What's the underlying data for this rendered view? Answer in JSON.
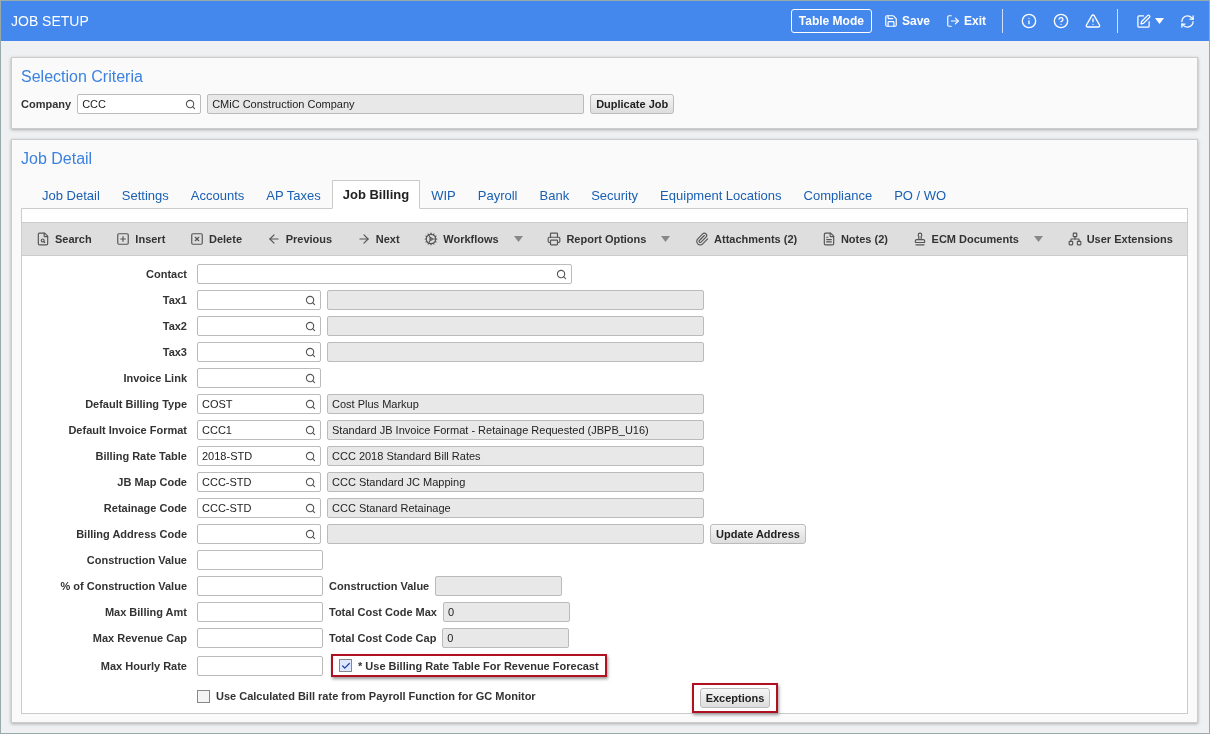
{
  "window": {
    "title": "JOB SETUP"
  },
  "header_actions": {
    "table_mode": "Table Mode",
    "save": "Save",
    "exit": "Exit"
  },
  "selection": {
    "title": "Selection Criteria",
    "company_label": "Company",
    "company_code": "CCC",
    "company_name": "CMiC Construction Company",
    "button": "Duplicate Job"
  },
  "detail": {
    "title": "Job Detail",
    "tabs": [
      {
        "label": "Job Detail",
        "selected": false
      },
      {
        "label": "Settings",
        "selected": false
      },
      {
        "label": "Accounts",
        "selected": false
      },
      {
        "label": "AP Taxes",
        "selected": false
      },
      {
        "label": "Job Billing",
        "selected": true
      },
      {
        "label": "WIP",
        "selected": false
      },
      {
        "label": "Payroll",
        "selected": false
      },
      {
        "label": "Bank",
        "selected": false
      },
      {
        "label": "Security",
        "selected": false
      },
      {
        "label": "Equipment Locations",
        "selected": false
      },
      {
        "label": "Compliance",
        "selected": false
      },
      {
        "label": "PO / WO",
        "selected": false
      }
    ],
    "toolbar": [
      {
        "label": "Search",
        "dropdown": false
      },
      {
        "label": "Insert",
        "dropdown": false
      },
      {
        "label": "Delete",
        "dropdown": false
      },
      {
        "label": "Previous",
        "dropdown": false
      },
      {
        "label": "Next",
        "dropdown": false
      },
      {
        "label": "Workflows",
        "dropdown": true
      },
      {
        "label": "Report Options",
        "dropdown": true
      },
      {
        "label": "Attachments (2)",
        "dropdown": false
      },
      {
        "label": "Notes (2)",
        "dropdown": false
      },
      {
        "label": "ECM Documents",
        "dropdown": true
      },
      {
        "label": "User Extensions",
        "dropdown": false
      }
    ],
    "fields": [
      {
        "kind": "search_wide",
        "label": "Contact"
      },
      {
        "kind": "lookup_desc",
        "label": "Tax1"
      },
      {
        "kind": "lookup_desc",
        "label": "Tax2"
      },
      {
        "kind": "lookup_desc",
        "label": "Tax3"
      },
      {
        "kind": "lookup",
        "label": "Invoice Link"
      },
      {
        "kind": "lookup_desc",
        "label": "Default Billing Type",
        "value": "COST",
        "description": "Cost Plus Markup"
      },
      {
        "kind": "lookup_desc",
        "label": "Default Invoice Format",
        "value": "CCC1",
        "description": "Standard JB Invoice Format - Retainage Requested (JBPB_U16)"
      },
      {
        "kind": "lookup_desc",
        "label": "Billing Rate Table",
        "value": "2018-STD",
        "description": "CCC 2018 Standard Bill Rates"
      },
      {
        "kind": "lookup_desc",
        "label": "JB Map Code",
        "value": "CCC-STD",
        "description": "CCC Standard JC Mapping"
      },
      {
        "kind": "lookup_desc",
        "label": "Retainage Code",
        "value": "CCC-STD",
        "description": "CCC Stanard Retainage"
      },
      {
        "kind": "lookup_desc",
        "label": "Billing Address Code",
        "button": "Update Address"
      },
      {
        "kind": "text",
        "label": "Construction Value"
      },
      {
        "kind": "text_pair",
        "label": "% of Construction Value",
        "side_label": "Construction Value"
      },
      {
        "kind": "text_pair",
        "label": "Max Billing Amt",
        "side_label": "Total Cost Code Max",
        "side_value": "0"
      },
      {
        "kind": "text_pair",
        "label": "Max Revenue Cap",
        "side_label": "Total Cost Code Cap",
        "side_value": "0"
      },
      {
        "kind": "text_check",
        "label": "Max Hourly Rate",
        "check_label": "* Use Billing Rate Table For Revenue Forecast",
        "checked": true,
        "highlighted": true
      }
    ],
    "bottom_check": {
      "label": "Use Calculated Bill rate from Payroll Function for GC Monitor",
      "checked": false
    },
    "bottom_button": {
      "label": "Exceptions",
      "highlighted": true
    }
  }
}
